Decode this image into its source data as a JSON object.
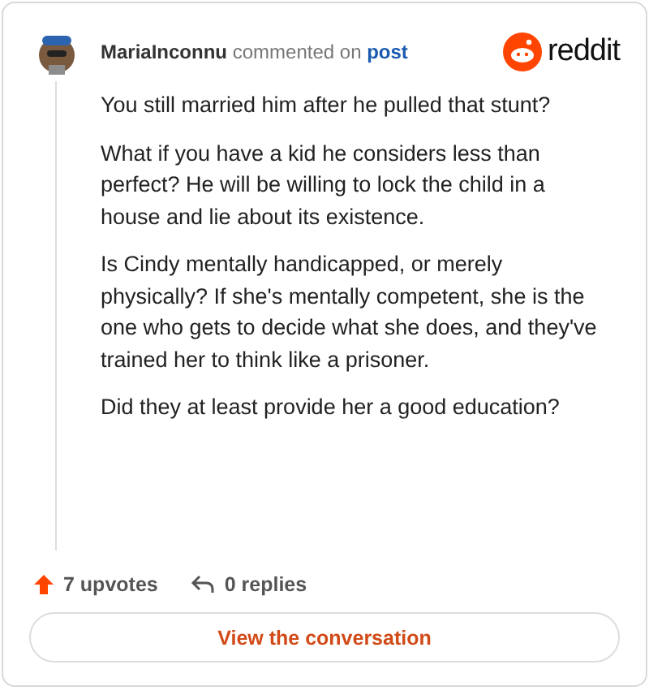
{
  "comment": {
    "author": "MariaInconnu",
    "action": "commented on",
    "target": "post",
    "paragraphs": [
      "You still married him after he pulled that stunt?",
      "What if you have a kid he considers less than perfect? He will be willing to lock the child in a house and lie about its existence.",
      "Is Cindy mentally handicapped, or merely physically? If she's mentally competent, she is the one who gets to decide what she does, and they've trained her to think like a prisoner.",
      "Did they at least provide her a good education?"
    ]
  },
  "brand": {
    "name": "reddit"
  },
  "stats": {
    "upvotes": "7 upvotes",
    "replies": "0 replies"
  },
  "button": {
    "label": "View the conversation"
  }
}
